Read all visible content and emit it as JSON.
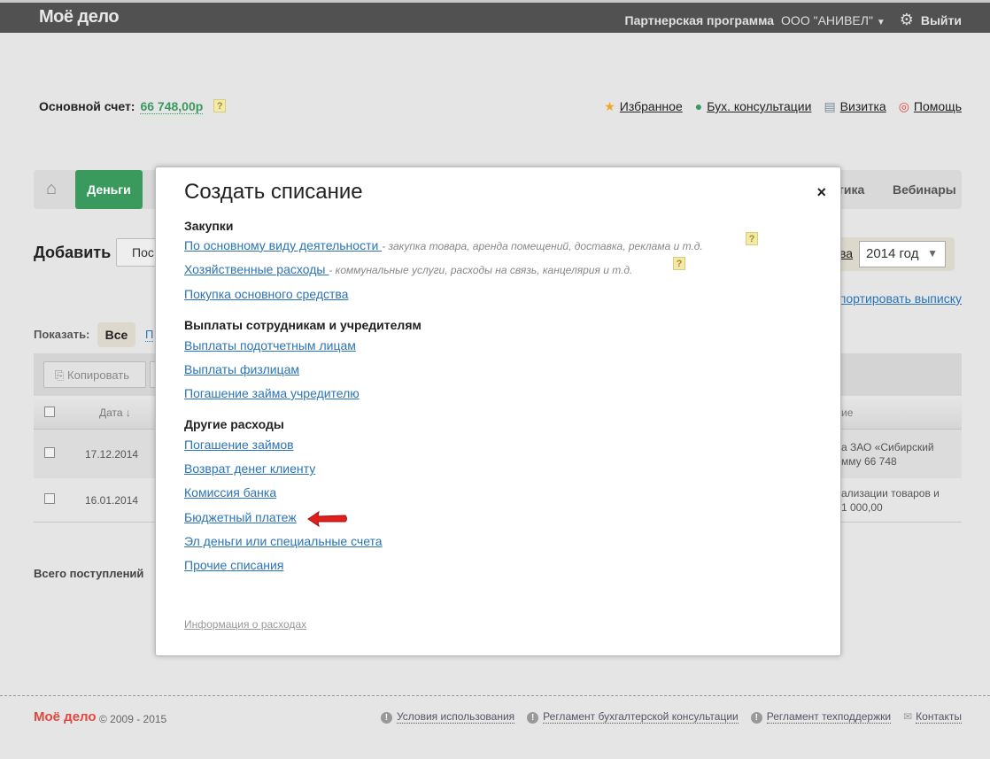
{
  "header": {
    "logo": "Моё дело",
    "partner": "Партнерская программа",
    "company": "ООО \"АНИВЕЛ\"",
    "logout": "Выйти"
  },
  "account": {
    "label": "Основной счет:",
    "amount": "66 748,00р",
    "help": "?"
  },
  "top_links": [
    "Избранное",
    "Бух. консультации",
    "Визитка",
    "Помощь"
  ],
  "nav": {
    "money": "Деньги",
    "analytics_partial": "тика",
    "webinars": "Вебинары"
  },
  "add": {
    "label": "Добавить",
    "button_partial": "Пос"
  },
  "period": {
    "link_partial": "ва",
    "year": "2014 год"
  },
  "export_partial": "портировать выписку",
  "filter": {
    "label": "Показать:",
    "all": "Все",
    "other_partial": "П"
  },
  "toolbar": {
    "copy": "Копировать"
  },
  "table": {
    "date_header": "Дата ↓",
    "desc_header_partial": "ие",
    "rows": [
      {
        "date": "17.12.2014",
        "desc1": "а ЗАО «Сибирский",
        "desc2": "мму 66 748"
      },
      {
        "date": "16.01.2014",
        "desc1": "ализации товаров и",
        "desc2": "1 000,00"
      }
    ]
  },
  "total_label": "Всего поступлений",
  "modal": {
    "title": "Создать списание",
    "close": "×",
    "sections": [
      {
        "title": "Закупки",
        "items": [
          {
            "label": "По основному виду деятельности",
            "hint": "- закупка товара, аренда помещений, доставка, реклама и т.д."
          },
          {
            "label": "Хозяйственные расходы",
            "hint": "- коммунальные услуги, расходы на связь, канцелярия и т.д."
          },
          {
            "label": "Покупка основного средства"
          }
        ]
      },
      {
        "title": "Выплаты сотрудникам и учредителям",
        "items": [
          {
            "label": "Выплаты подотчетным лицам"
          },
          {
            "label": "Выплаты физлицам"
          },
          {
            "label": "Погашение займа учредителю"
          }
        ]
      },
      {
        "title": "Другие расходы",
        "items": [
          {
            "label": "Погашение займов"
          },
          {
            "label": "Возврат денег клиенту"
          },
          {
            "label": "Комиссия банка"
          },
          {
            "label": "Бюджетный платеж"
          },
          {
            "label": "Эл деньги или специальные счета"
          },
          {
            "label": "Прочие списания"
          }
        ]
      }
    ],
    "info": "Информация о расходах"
  },
  "footer": {
    "logo": "Моё дело",
    "copyright": "© 2009 - 2015",
    "links": [
      "Условия использования",
      "Регламент бухгалтерской консультации",
      "Регламент техподдержки",
      "Контакты"
    ]
  },
  "colors": {
    "header": "#515151",
    "accent": "#3a9a5e",
    "link": "#2a74b7",
    "arrow": "#e0201c"
  }
}
